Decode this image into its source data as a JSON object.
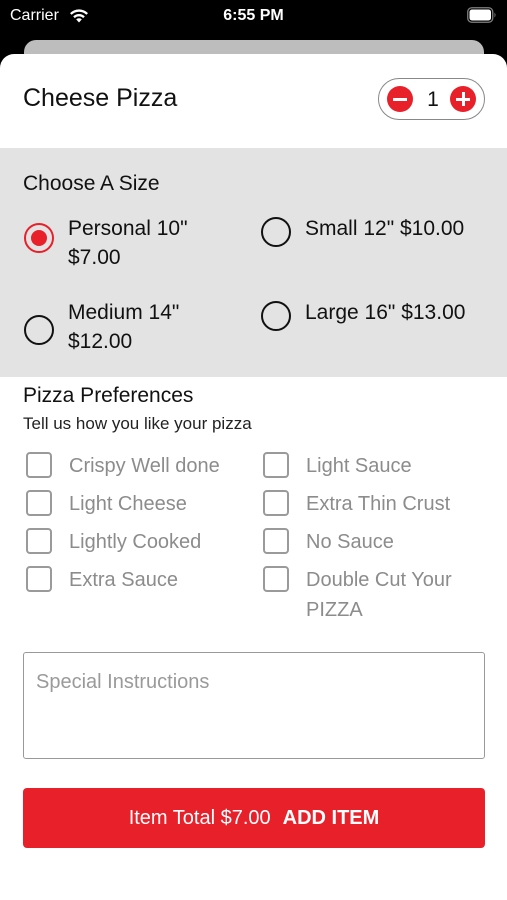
{
  "status_bar": {
    "carrier": "Carrier",
    "time": "6:55 PM"
  },
  "item": {
    "title": "Cheese Pizza",
    "quantity": "1"
  },
  "size": {
    "title": "Choose A Size",
    "options": [
      {
        "line1": "Personal 10\"",
        "line2": "$7.00",
        "selected": true
      },
      {
        "line1": "Small 12\" $10.00",
        "line2": "",
        "selected": false
      },
      {
        "line1": "Medium 14\"",
        "line2": "$12.00",
        "selected": false
      },
      {
        "line1": "Large 16\" $13.00",
        "line2": "",
        "selected": false
      }
    ]
  },
  "preferences": {
    "title": "Pizza Preferences",
    "subtitle": "Tell us how you like your pizza",
    "options": [
      {
        "line1": "Crispy Well done",
        "line2": ""
      },
      {
        "line1": "Light Sauce",
        "line2": ""
      },
      {
        "line1": "Light Cheese",
        "line2": ""
      },
      {
        "line1": "Extra Thin Crust",
        "line2": ""
      },
      {
        "line1": "Lightly Cooked",
        "line2": ""
      },
      {
        "line1": "No Sauce",
        "line2": ""
      },
      {
        "line1": "Extra Sauce",
        "line2": ""
      },
      {
        "line1": "Double Cut Your",
        "line2": "PIZZA"
      }
    ]
  },
  "instructions": {
    "placeholder": "Special Instructions"
  },
  "add_button": {
    "total": "Item Total $7.00",
    "action": "ADD ITEM"
  },
  "colors": {
    "accent": "#e8202a",
    "section_bg": "#e3e3e3"
  }
}
